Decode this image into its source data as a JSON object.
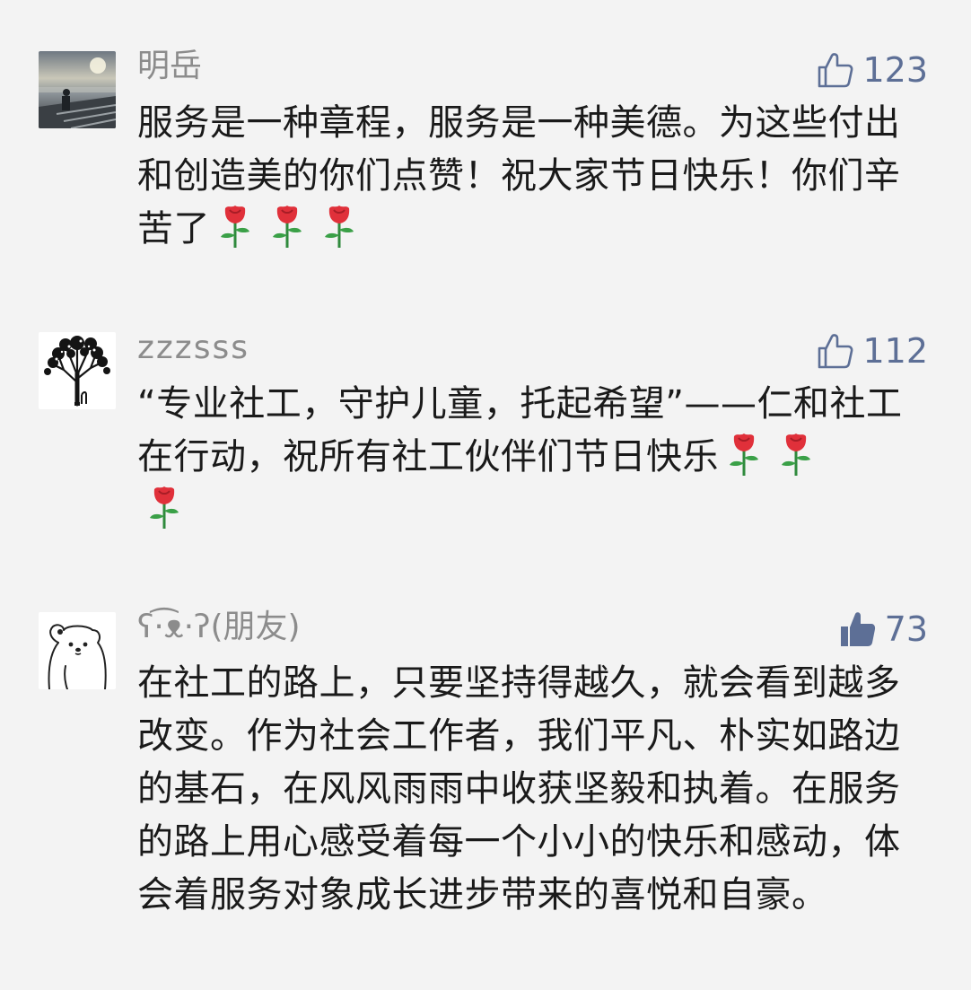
{
  "comments": [
    {
      "nickname": "明岳",
      "likes": "123",
      "liked": false,
      "avatar": "seaside-photo-avatar",
      "text": "服务是一种章程，服务是一种美德。为这些付出和创造美的你们点赞！祝大家节日快乐！你们辛苦了",
      "roses": 3
    },
    {
      "nickname": "zzzsss",
      "likes": "112",
      "liked": false,
      "avatar": "tree-silhouette-avatar",
      "text": "“专业社工，守护儿童，托起希望”——仁和社工在行动，祝所有社工伙伴们节日快乐",
      "roses": 3
    },
    {
      "nickname": "ʕ·͡ᴥ·ʔ(朋友)",
      "likes": "73",
      "liked": true,
      "avatar": "white-bear-avatar",
      "text": "在社工的路上，只要坚持得越久，就会看到越多改变。作为社会工作者，我们平凡、朴实如路边的基石，在风风雨雨中收获坚毅和执着。在服务的路上用心感受着每一个小小的快乐和感动，体会着服务对象成长进步带来的喜悦和自豪。",
      "roses": 0
    }
  ],
  "colors": {
    "background": "#f3f3f3",
    "nickname": "#8c8c8c",
    "like_accent": "#5d6f96",
    "text": "#1a1a1a"
  }
}
